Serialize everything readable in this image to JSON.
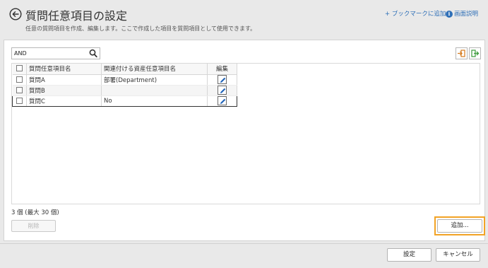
{
  "header": {
    "title": "質問任意項目の設定",
    "description": "任意の質問項目を作成、編集します。ここで作成した項目を質問項目として使用できます。",
    "bookmark_link": "+ ブックマークに追加",
    "help_link": "画面説明",
    "icons": {
      "back": "back-arrow-circle-icon",
      "info": "info-icon"
    }
  },
  "search": {
    "value": "AND",
    "placeholder": "",
    "icon": "search-icon"
  },
  "toolbar": {
    "import_icon": "import-icon",
    "export_icon": "export-icon"
  },
  "grid": {
    "columns": [
      "",
      "質問任意項目名",
      "関連付ける資産任意項目名",
      "編集"
    ],
    "rows": [
      {
        "name": "質問A",
        "linked": "部署(Department)",
        "selected": false
      },
      {
        "name": "質問B",
        "linked": "",
        "selected": false
      },
      {
        "name": "質問C",
        "linked": "No",
        "selected": true
      }
    ],
    "edit_icon": "pencil-icon"
  },
  "footer": {
    "count_text": "3 個 (最大 30 個)",
    "delete_label": "削除",
    "add_label": "追加...",
    "set_label": "設定",
    "cancel_label": "キャンセル"
  },
  "colors": {
    "link": "#2e6fb7",
    "highlight": "#f2a325",
    "edit_icon": "#1f63b8"
  }
}
